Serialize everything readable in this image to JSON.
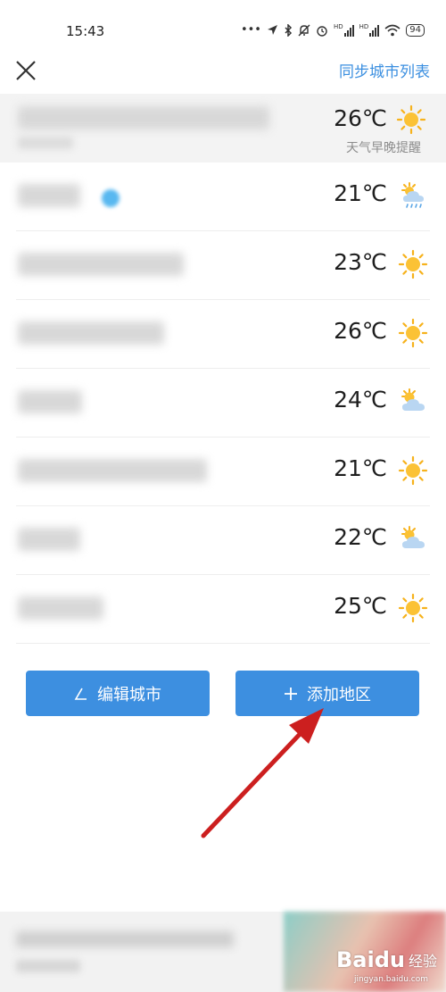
{
  "status_bar": {
    "time": "15:43",
    "battery": "94",
    "network_a": "HD",
    "network_b": "HD"
  },
  "header": {
    "close_icon": "close-icon",
    "sync_label": "同步城市列表"
  },
  "cities": [
    {
      "name": "██████████████",
      "temp": "26℃",
      "weather": "sunny",
      "note": "天气早晚提醒"
    },
    {
      "name": "████",
      "temp": "21℃",
      "weather": "rain-cloud"
    },
    {
      "name": "████████████",
      "temp": "23℃",
      "weather": "sunny"
    },
    {
      "name": "█████████",
      "temp": "26℃",
      "weather": "sunny"
    },
    {
      "name": "████",
      "temp": "24℃",
      "weather": "partly-cloudy"
    },
    {
      "name": "█████████████",
      "temp": "21℃",
      "weather": "sunny"
    },
    {
      "name": "████",
      "temp": "22℃",
      "weather": "partly-cloudy"
    },
    {
      "name": "█████",
      "temp": "25℃",
      "weather": "sunny"
    }
  ],
  "buttons": {
    "edit_label": "编辑城市",
    "add_label": "添加地区"
  },
  "watermark": {
    "brand": "Baidu",
    "jingyan": "经验",
    "url": "jingyan.baidu.com"
  },
  "colors": {
    "accent": "#3d8fe0",
    "link": "#3b8fe0",
    "arrow": "#cc1f1f"
  }
}
